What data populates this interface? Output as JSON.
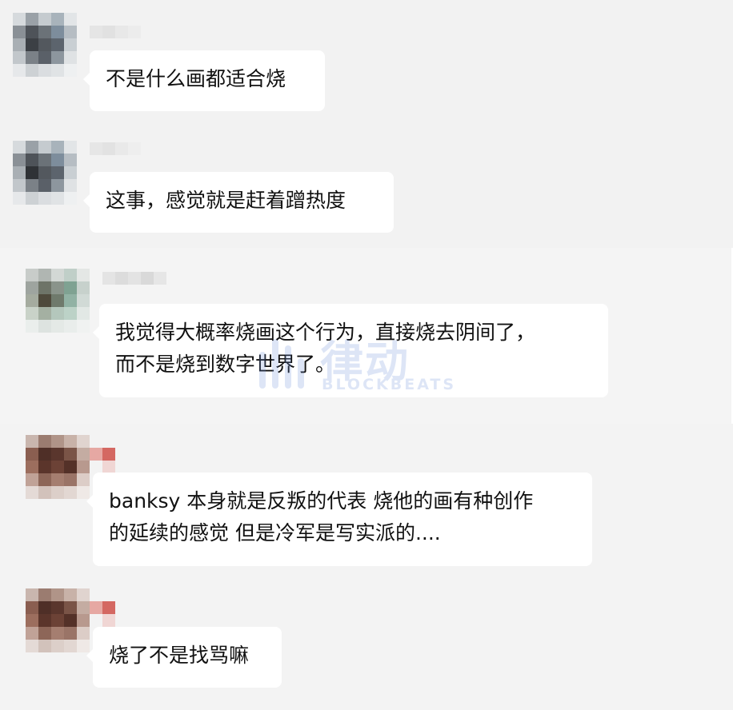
{
  "messages": [
    {
      "lines": [
        "不是什么画都适合烧"
      ]
    },
    {
      "lines": [
        "这事，感觉就是赶着蹭热度"
      ]
    },
    {
      "lines": [
        "我觉得大概率烧画这个行为，直接烧去阴间了，",
        "而不是烧到数字世界了。"
      ]
    },
    {
      "lines": [
        "banksy 本身就是反叛的代表 烧他的画有种创作",
        "的延续的感觉 但是冷军是写实派的...."
      ]
    },
    {
      "lines": [
        "烧了不是找骂嘛"
      ]
    }
  ],
  "watermark": {
    "brand_cn": "律动",
    "brand_en": "BLOCKBEATS"
  },
  "colors": {
    "background": "#f3f3f3",
    "bubble": "#ffffff",
    "text": "#111111",
    "watermark": "#6a8ed8"
  }
}
